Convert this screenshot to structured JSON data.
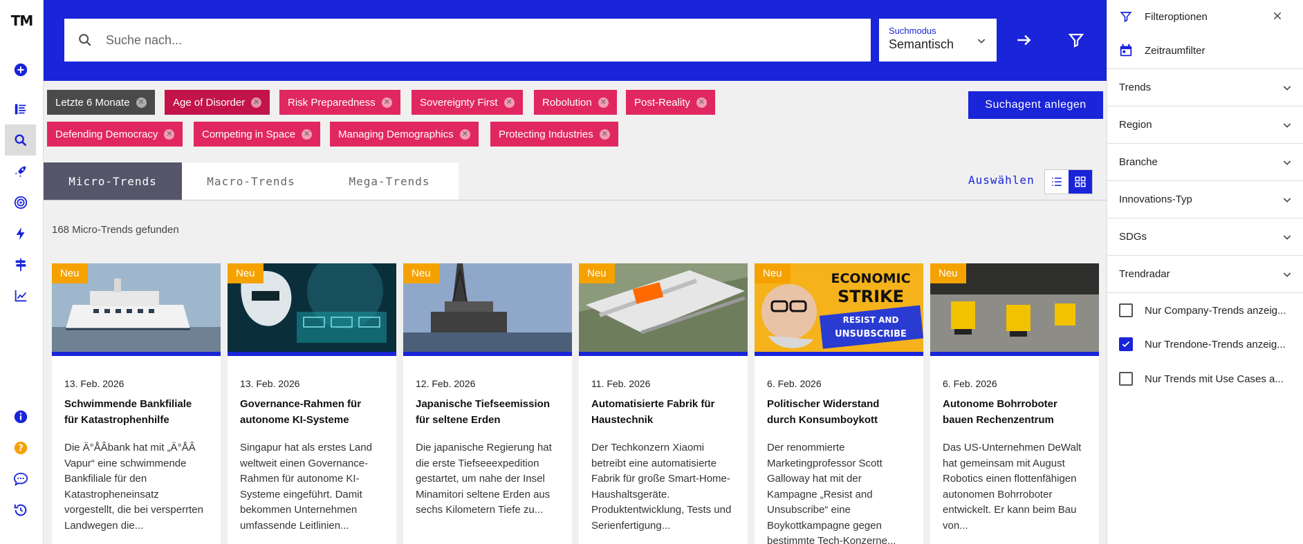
{
  "app": {
    "logo": "TM"
  },
  "header": {
    "search_placeholder": "Suche nach...",
    "mode_label": "Suchmodus",
    "mode_value": "Semantisch"
  },
  "chips": [
    {
      "label": "Letzte 6 Monate"
    },
    {
      "label": "Age of Disorder"
    },
    {
      "label": "Risk Preparedness"
    },
    {
      "label": "Sovereignty First"
    },
    {
      "label": "Robolution"
    },
    {
      "label": "Post-Reality"
    },
    {
      "label": "Defending Democracy"
    },
    {
      "label": "Competing in Space"
    },
    {
      "label": "Managing Demographics"
    },
    {
      "label": "Protecting Industries"
    }
  ],
  "agent_button": "Suchagent anlegen",
  "tabs": [
    {
      "label": "Micro-Trends"
    },
    {
      "label": "Macro-Trends"
    },
    {
      "label": "Mega-Trends"
    }
  ],
  "select_label": "Auswählen",
  "found_text": "168 Micro-Trends gefunden",
  "cards": [
    {
      "badge": "Neu",
      "date": "13. Feb. 2026",
      "title": "Schwimmende Bankfiliale für Katastrophenhilfe",
      "desc": "Die Ä°ÅÂbank hat mit „Ä°ÅÂ Vapur“ eine schwimmende Bankfiliale für den Katastropheneinsatz vorgestellt, die bei versperrten Landwegen die..."
    },
    {
      "badge": "Neu",
      "date": "13. Feb. 2026",
      "title": "Governance-Rahmen für autonome KI-Systeme",
      "desc": "Singapur hat als erstes Land weltweit einen Governance-Rahmen für autonome KI-Systeme eingeführt. Damit bekommen Unternehmen umfassende Leitlinien..."
    },
    {
      "badge": "Neu",
      "date": "12. Feb. 2026",
      "title": "Japanische Tiefseemission für seltene Erden",
      "desc": "Die japanische Regierung hat die erste Tiefseeexpedition gestartet, um nahe der Insel Minamitori seltene Erden aus sechs Kilometern Tiefe zu..."
    },
    {
      "badge": "Neu",
      "date": "11. Feb. 2026",
      "title": "Automatisierte Fabrik für Haustechnik",
      "desc": "Der Techkonzern Xiaomi betreibt eine automatisierte Fabrik für große Smart-Home-Haushaltsgeräte. Produktentwicklung, Tests und Serienfertigung..."
    },
    {
      "badge": "Neu",
      "date": "6. Feb. 2026",
      "title": "Politischer Widerstand durch Konsumboykott",
      "desc": "Der renommierte Marketingprofessor Scott Galloway hat mit der Kampagne „Resist and Unsubscribe“ eine Boykottkampagne gegen bestimmte Tech-Konzerne..."
    },
    {
      "badge": "Neu",
      "date": "6. Feb. 2026",
      "title": "Autonome Bohrroboter bauen Rechenzentrum",
      "desc": "Das US-Unternehmen DeWalt hat gemeinsam mit August Robotics einen flottenfähigen autonomen Bohrroboter entwickelt. Er kann beim Bau von..."
    }
  ],
  "panel": {
    "filter_title": "Filteroptionen",
    "time_filter": "Zeitraumfilter",
    "sections": [
      "Trends",
      "Region",
      "Branche",
      "Innovations-Typ",
      "SDGs",
      "Trendradar"
    ],
    "checkboxes": [
      {
        "label": "Nur Company-Trends anzeig...",
        "checked": false
      },
      {
        "label": "Nur Trendone-Trends anzeig...",
        "checked": true
      },
      {
        "label": "Nur Trends mit Use Cases a...",
        "checked": false
      }
    ]
  },
  "image_texts": {
    "economic": "ECONOMIC",
    "strike": "STRIKE",
    "resist": "RESIST AND",
    "unsubscribe": "UNSUBSCRIBE"
  },
  "colors": {
    "brand_blue": "#1a24d8",
    "chip_red": "#e0275f",
    "badge_orange": "#f5a200",
    "tab_active": "#55566a"
  }
}
